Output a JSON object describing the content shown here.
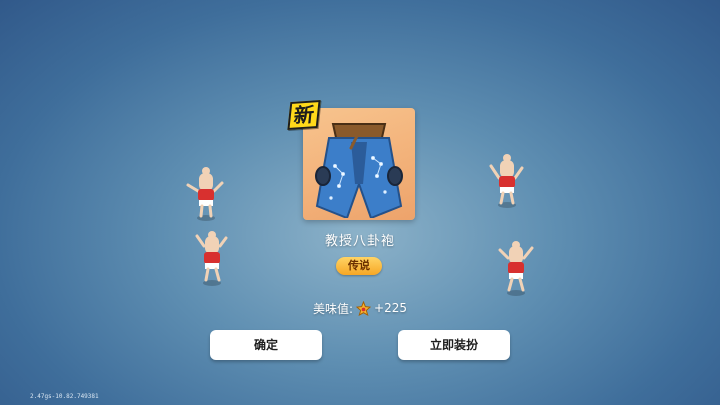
{
  "reward": {
    "new_badge": "新",
    "item_name": "教授八卦袍",
    "rarity": "传说",
    "taste_label": "美味值:",
    "taste_value": "+225",
    "icon": "robe-icon"
  },
  "buttons": {
    "confirm": "确定",
    "equip_now": "立即装扮"
  },
  "debug": {
    "build_info": "2.47gs-10.82.749381"
  },
  "colors": {
    "card_bg": "#f3b27a",
    "rarity_pill": "#f7a725",
    "new_badge": "#ffd91a",
    "background": "#5f8fb2"
  }
}
